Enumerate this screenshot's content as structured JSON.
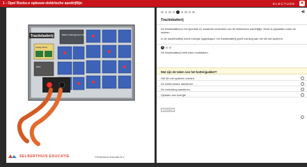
{
  "window": {
    "title": "1 - Opel Rocks-e opbouw elektrische aandrijflijn",
    "brand": "ELECTUDE",
    "close_label": "✕"
  },
  "illustration": {
    "battery_label": "Tractiebatterij",
    "bms_label": "Battery Management System",
    "box_label": "Opslag 400 Ah",
    "relay_label": "Motor",
    "icon_name": "traction-battery-illustration"
  },
  "footer": {
    "brand": "SELBERTHUIS EDUCATIE",
    "copyright": "©Selberthuis Educatie B.V."
  },
  "content": {
    "progress_dots": 9,
    "active_dot": 4,
    "section_title": "Tractiebatterij",
    "para1": "De tractiebatterij is het grootste en zwaarste onderdeel van de elektrische aandrijflijn. Deze is geplaatst onder de stoelen.",
    "para2": "In de tractiebatterij wordt energie opgeslagen. De tractiebatterij geeft voeding aan het 48 volt systeem.",
    "sub_number": "2",
    "para3": "De tractiebatterij heeft twee hoofdtaken.",
    "question": "Wat zijn de taken van het batterijpakket?",
    "options": [
      "Het 48 volt systeem voeden.",
      "De elektromotor aansturen.",
      "De verlichting aansturen.",
      "Opslaan van energie."
    ],
    "submit_label": "Controleer"
  },
  "icons": {
    "speaker": "speaker-icon",
    "help": "help-icon",
    "logo": "selberthuis-logo-icon"
  }
}
